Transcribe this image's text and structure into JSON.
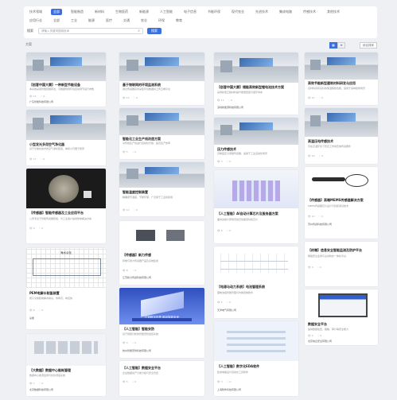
{
  "nav": {
    "row1": [
      "技术领域",
      "全部",
      "智能制造",
      "新材料",
      "生物医药",
      "新能源",
      "人工智能",
      "电子信息",
      "节能环保",
      "现代农业",
      "先进技术",
      "集成电路",
      "传感技术",
      "其他技术"
    ],
    "row1_active": 1,
    "row2": [
      "应用行业",
      "全部",
      "工业",
      "能源",
      "医疗",
      "交通",
      "农业",
      "环保",
      "教育"
    ]
  },
  "search": {
    "label": "搜索",
    "placeholder": "请输入关键词搜索技术",
    "button": "搜索"
  },
  "toolbar": {
    "count": "方案",
    "sort": "综合排序"
  },
  "cards": [
    {
      "title": "【创客中国大赛】一种新型节能设备",
      "desc": "本系统采用智能控制算法，可根据现场环境自动调节运行参数",
      "stats": [
        "14",
        "0"
      ],
      "company": "广东智能科技有限公司"
    },
    {
      "title": "基于物联网的环境监测系统",
      "desc": "通过传感器实时采集环境数据并上传云端平台",
      "stats": [
        "15",
        "0"
      ],
      "company": ""
    },
    {
      "title": "【创客中国大赛】储能高效新型锂电池技术方案",
      "desc": "采用新型正极材料提升能量密度与循环寿命",
      "stats": [
        "11",
        "0"
      ],
      "company": "深圳新能源科技有限公司"
    },
    {
      "title": "高效节能新型建筑材料研发与应用",
      "desc": "该材料具有良好的保温隔热性能，适用于多种建筑场景",
      "stats": [
        "27",
        "0"
      ],
      "company": ""
    },
    {
      "title": "智能化工业生产线改造方案",
      "desc": "对传统生产线进行自动化升级，提高生产效率",
      "stats": [
        "5",
        "0"
      ],
      "company": ""
    },
    {
      "title": "小型发光多用空气净化器",
      "desc": "基于光催化技术的空气净化装置，体积小巧便于携带",
      "stats": [
        "17",
        "0"
      ],
      "company": ""
    },
    {
      "title": "压力传感技术",
      "desc": "高精度压力测量传感器，适用于工业自动化场景",
      "stats": [
        "3",
        "0"
      ],
      "company": ""
    },
    {
      "title": "高温压电传感技术",
      "desc": "可在高温环境下稳定工作的压电传感器件",
      "stats": [
        "23",
        "0"
      ],
      "company": ""
    },
    {
      "title": "智能温度控制装置",
      "desc": "精确调节温度，节能环保，广泛用于工业和民用",
      "stats": [
        "12",
        "0"
      ],
      "company": ""
    },
    {
      "title": "【传感器】智能传感器及工业应用平台",
      "desc": "公司专注于智能传感器研发，为工业用户提供整体解决方案",
      "stats": [
        "9",
        "0"
      ],
      "company": ""
    },
    {
      "title": "【人工智能】AI自动计算芯片及服务器方案",
      "desc": "面向边缘计算场景的高性能低功耗芯片",
      "stats": [
        "6",
        "0"
      ],
      "company": ""
    },
    {
      "title": "【传感器】高端MEMS传感器解决方案",
      "desc": "MEMS传感器芯片设计与封装测试技术",
      "stats": [
        "10",
        "0"
      ],
      "company": "苏州传感科技有限公司"
    },
    {
      "title": "【传感器】新力传感",
      "desc": "称重与测力传感器产品及系统集成",
      "stats": [
        "8",
        "0"
      ],
      "company": "江苏新力传感科技有限公司"
    },
    {
      "title": "PEM电解水制氢装置",
      "desc": "质子交换膜电解水制氢，效率高、响应快",
      "stats": [
        "6",
        "0"
      ],
      "company": "氢能"
    },
    {
      "title": "【人工智能】智能安防",
      "desc": "基于视频分析的智能安防监控系统",
      "stats": [
        "4",
        "0"
      ],
      "company": "杭州智能安防科技有限公司"
    },
    {
      "title": "【电源与动力系统】电池管理系统",
      "desc": "锂电池组智能管理与均衡控制技术",
      "stats": [
        "5",
        "0"
      ],
      "company": "天津电气有限公司"
    },
    {
      "title": "【终端】信息安全智能监测及防护平台",
      "desc": "网络安全监测与主动防护一体化平台",
      "stats": [
        "3",
        "0"
      ],
      "company": ""
    },
    {
      "title": "【大数据】数据中心能耗管理",
      "desc": "数据中心能源监测与优化调度系统",
      "stats": [
        "7",
        "0"
      ],
      "company": "北京数据科技有限公司"
    },
    {
      "title": "【人工智能】数据安全平台",
      "desc": "企业数据资产分类分级与安全管控",
      "stats": [
        "5",
        "0"
      ],
      "company": ""
    },
    {
      "title": "数据安全平台",
      "desc": "提供数据加密、脱敏、审计等安全能力",
      "stats": [
        "4",
        "0"
      ],
      "company": "北京信息安全有限公司"
    },
    {
      "title": "【人工智能】数字化EDA软件",
      "desc": "集成电路设计自动化工具软件",
      "stats": [
        "3",
        "0"
      ],
      "company": "上海软件科技有限公司"
    }
  ],
  "banners": {
    "diagram_top": "海水淡化",
    "blue_iso": "打造数字世界 推动智能未来"
  },
  "colors": {
    "accent": "#3a6fe0",
    "background": "#eef0f4"
  }
}
